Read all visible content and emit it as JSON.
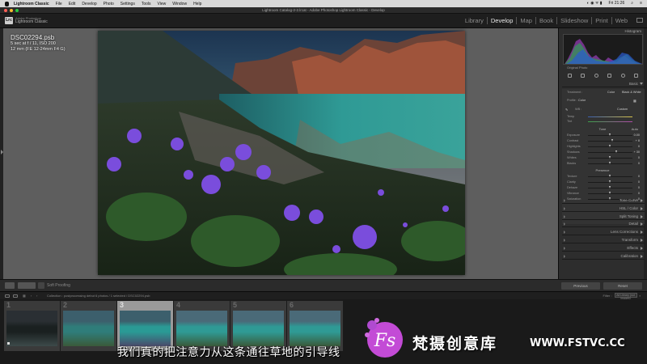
{
  "menubar": {
    "items": [
      "Lightroom Classic",
      "File",
      "Edit",
      "Develop",
      "Photo",
      "Settings",
      "Tools",
      "View",
      "Window",
      "Help"
    ],
    "time": "Fri 21:26"
  },
  "window": {
    "title": "Lightroom Catalog-2-2.lrcat - Adobe Photoshop Lightroom Classic - Develop"
  },
  "identity": {
    "logo": "Lrc",
    "line1": "Adobe Photoshop",
    "line2": "Lightroom Classic"
  },
  "modules": [
    "Library",
    "Develop",
    "Map",
    "Book",
    "Slideshow",
    "Print",
    "Web"
  ],
  "active_module": "Develop",
  "photo_info": {
    "filename": "DSC02294.psb",
    "exposure": "5 sec at f / 11, ISO 200",
    "lens": "12 mm (FE 12-24mm F4 G)"
  },
  "toolbar": {
    "soft_proofing": "Soft Proofing"
  },
  "right_panel": {
    "histogram_label": "Histogram",
    "histogram_meta": "Original Photo",
    "basic_label": "Basic",
    "treatment_label": "Treatment :",
    "treatment_color": "Color",
    "treatment_bw": "Black & White",
    "profile_label": "Profile :",
    "profile_value": "Color",
    "wb_label": "WB :",
    "wb_value": "Custom",
    "temp_label": "Temp",
    "tint_label": "Tint",
    "tone_label": "Tone",
    "tone_auto": "Auto",
    "presence_label": "Presence",
    "sliders_tone": [
      {
        "name": "Exposure",
        "value": "0.00",
        "pos": 0.5
      },
      {
        "name": "Contrast",
        "value": "+ 8",
        "pos": 0.55
      },
      {
        "name": "Highlights",
        "value": "0",
        "pos": 0.5
      },
      {
        "name": "Shadows",
        "value": "+ 30",
        "pos": 0.65
      },
      {
        "name": "Whites",
        "value": "0",
        "pos": 0.5
      },
      {
        "name": "Blacks",
        "value": "0",
        "pos": 0.5
      }
    ],
    "sliders_presence": [
      {
        "name": "Texture",
        "value": "0",
        "pos": 0.5
      },
      {
        "name": "Clarity",
        "value": "0",
        "pos": 0.5
      },
      {
        "name": "Dehaze",
        "value": "0",
        "pos": 0.5
      },
      {
        "name": "Vibrance",
        "value": "0",
        "pos": 0.5
      },
      {
        "name": "Saturation",
        "value": "0",
        "pos": 0.5
      }
    ],
    "sections": [
      "Tone Curve",
      "HSL / Color",
      "Split Toning",
      "Detail",
      "Lens Corrections",
      "Transform",
      "Effects",
      "Calibration"
    ],
    "previous_button": "Previous",
    "reset_button": "Reset"
  },
  "filmstrip": {
    "crumb": "Collection : postprocessing debut   6 photos / 1 selected / DSC02294.psb",
    "filter_label": "Filter :",
    "filter_value": "All Library (not images)",
    "cells": [
      {
        "num": "1"
      },
      {
        "num": "2"
      },
      {
        "num": "3"
      },
      {
        "num": "4"
      },
      {
        "num": "5"
      },
      {
        "num": "6"
      }
    ],
    "selected_index": 2
  },
  "watermark": {
    "subtitle": "我们真的把注意力从这条通往草地的引导线",
    "brand_cn": "梵摄创意库",
    "url": "WWW.FSTVC.CC"
  },
  "colors": {
    "accent_watermark": "#c34bd6"
  }
}
